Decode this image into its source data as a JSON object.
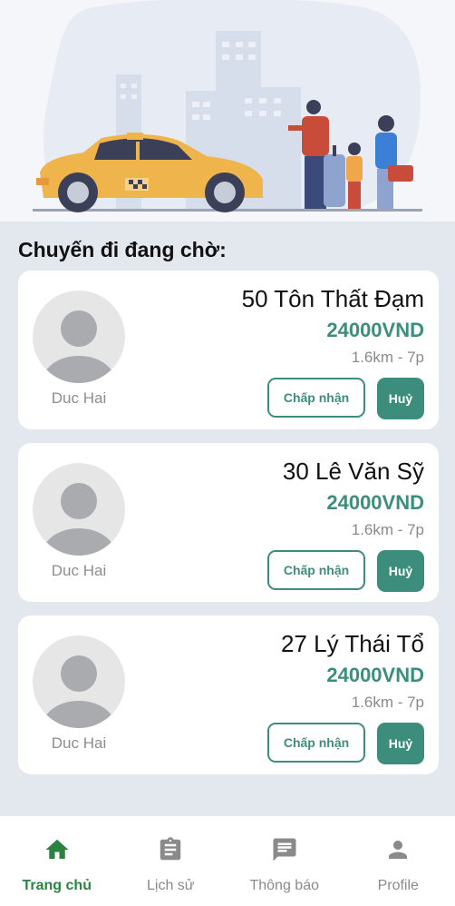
{
  "section_title": "Chuyến đi đang chờ:",
  "trips": [
    {
      "driver": "Duc Hai",
      "address": "50 Tôn Thất Đạm",
      "price": "24000VND",
      "meta": "1.6km - 7p",
      "accept": "Chấp nhận",
      "cancel": "Huỷ"
    },
    {
      "driver": "Duc Hai",
      "address": "30 Lê Văn Sỹ",
      "price": "24000VND",
      "meta": "1.6km - 7p",
      "accept": "Chấp nhận",
      "cancel": "Huỷ"
    },
    {
      "driver": "Duc Hai",
      "address": "27 Lý Thái Tổ",
      "price": "24000VND",
      "meta": "1.6km - 7p",
      "accept": "Chấp nhận",
      "cancel": "Huỷ"
    }
  ],
  "nav": [
    {
      "label": "Trang chủ",
      "icon": "home-icon",
      "active": true
    },
    {
      "label": "Lịch sử",
      "icon": "clipboard-icon",
      "active": false
    },
    {
      "label": "Thông báo",
      "icon": "message-icon",
      "active": false
    },
    {
      "label": "Profile",
      "icon": "person-icon",
      "active": false
    }
  ],
  "colors": {
    "accent": "#3d8d7c",
    "nav_active": "#2b8342",
    "background": "#e3e7ee"
  }
}
